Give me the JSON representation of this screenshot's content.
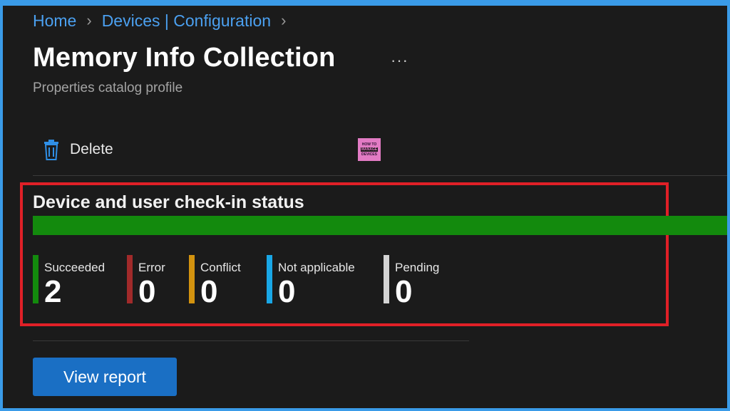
{
  "breadcrumb": {
    "items": [
      "Home",
      "Devices | Configuration"
    ]
  },
  "page": {
    "title": "Memory Info Collection",
    "subtitle": "Properties catalog profile",
    "more_icon": "ellipsis-icon"
  },
  "toolbar": {
    "delete_label": "Delete",
    "delete_icon": "trash-icon"
  },
  "brand": {
    "logo_top": "HOW TO",
    "logo_mid": "MANAGE",
    "logo_bottom": "DEVICES"
  },
  "checkin": {
    "title": "Device and user check-in status",
    "progress": {
      "succeeded_fraction": 1.0,
      "color": "#138a0d"
    },
    "statuses": [
      {
        "label": "Succeeded",
        "count": "2",
        "color": "#138a0d"
      },
      {
        "label": "Error",
        "count": "0",
        "color": "#a12a2a"
      },
      {
        "label": "Conflict",
        "count": "0",
        "color": "#d3930f"
      },
      {
        "label": "Not applicable",
        "count": "0",
        "color": "#19a7e6"
      },
      {
        "label": "Pending",
        "count": "0",
        "color": "#d4d4d4"
      }
    ]
  },
  "actions": {
    "view_report_label": "View report"
  },
  "colors": {
    "highlight": "#e02027",
    "accent": "#1a6fc4",
    "link": "#4ba0f0"
  }
}
